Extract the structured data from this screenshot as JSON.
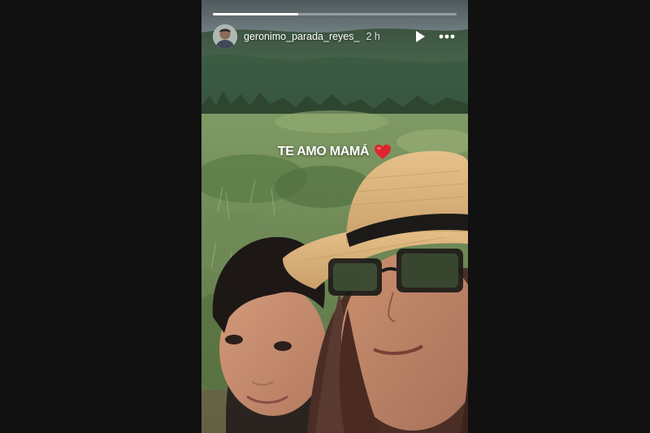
{
  "story": {
    "username": "geronimo_parada_reyes_",
    "time": "2 h",
    "progress": 0.35,
    "caption": "TE AMO MAMÁ",
    "caption_emoji": "heart-icon",
    "icons": {
      "play": "play-icon",
      "more": "more-horizontal-icon",
      "avatar": "avatar"
    },
    "colors": {
      "page_background": "#111111",
      "heart": "#e0242f",
      "text": "#ffffff"
    }
  }
}
